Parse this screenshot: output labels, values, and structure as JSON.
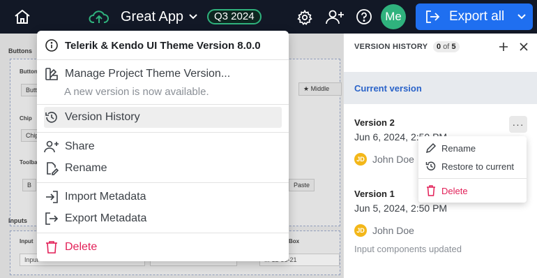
{
  "app": {
    "title": "Great App",
    "quarter": "Q3 2024"
  },
  "user": {
    "initials": "Me"
  },
  "toolbar": {
    "export_label": "Export all"
  },
  "workspace": {
    "sections": [
      "Buttons",
      "Inputs"
    ],
    "groups": [
      "Button",
      "Chip",
      "Toolbar",
      "Input",
      "Box"
    ],
    "buttons": [
      "Butt",
      "Middle",
      "Chip",
      "B",
      "Paste"
    ],
    "inputs": [
      "Input",
      "...-12-33-21"
    ]
  },
  "menu": {
    "header": "Telerik & Kendo UI Theme Version 8.0.0",
    "manage": "Manage Project Theme Version...",
    "manage_sub": "A new version is now available.",
    "history": "Version History",
    "share": "Share",
    "rename": "Rename",
    "import": "Import Metadata",
    "export": "Export Metadata",
    "delete": "Delete"
  },
  "panel": {
    "title": "VERSION HISTORY",
    "count_current": "0",
    "count_of": "of",
    "count_total": "5",
    "current_label": "Current version",
    "versions": [
      {
        "title": "Version 2",
        "date": "Jun 6, 2024, 2:50 PM",
        "user_initials": "JD",
        "user": "John Doe",
        "desc": ""
      },
      {
        "title": "Version 1",
        "date": "Jun 5, 2024, 2:50 PM",
        "user_initials": "JD",
        "user": "John Doe",
        "desc": "Input components updated"
      }
    ]
  },
  "context_menu": {
    "rename": "Rename",
    "restore": "Restore to current",
    "delete": "Delete"
  }
}
